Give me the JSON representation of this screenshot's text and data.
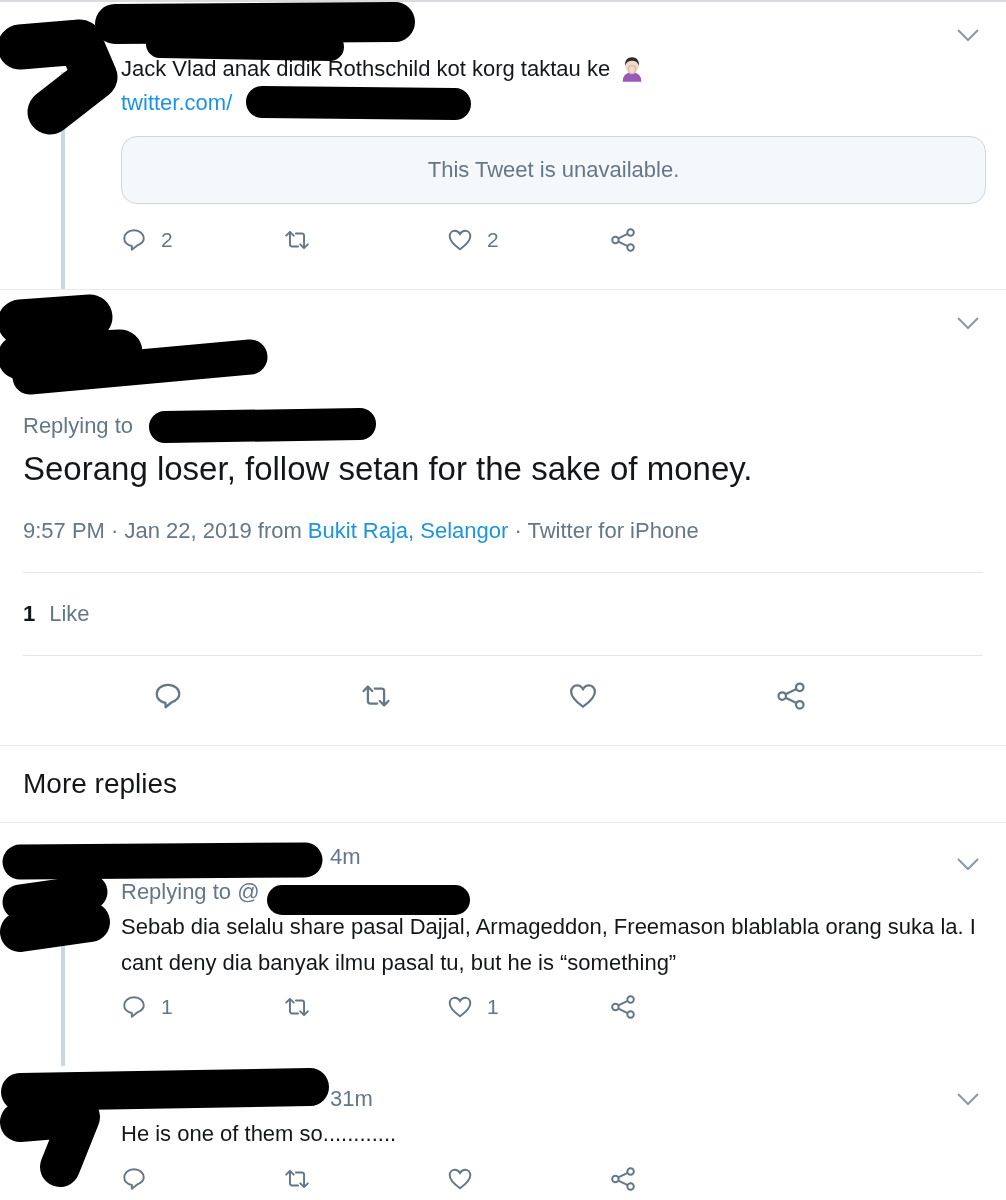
{
  "reply_above": {
    "text": "Jack Vlad anak didik Rothschild kot korg taktau ke",
    "link": "twitter.com/",
    "quoted": "This Tweet is unavailable.",
    "reply_count": "2",
    "like_count": "2"
  },
  "main_tweet": {
    "replying_to": "Replying to",
    "text": "Seorang loser, follow setan for the sake of money.",
    "time": "9:57 PM · Jan 22, 2019 from",
    "location": "Bukit Raja, Selangor",
    "source": "· Twitter for iPhone",
    "likes_count": "1",
    "likes_label": "Like"
  },
  "more_replies": {
    "title": "More replies",
    "replies": [
      {
        "time": "4m",
        "replying_to": "Replying to @",
        "text": "Sebab dia selalu share pasal Dajjal, Armageddon, Freemason blablabla orang suka la. I cant deny dia banyak ilmu pasal tu, but he is “something”",
        "reply_count": "1",
        "like_count": "1"
      },
      {
        "time": "31m",
        "text": "He is one of them so............"
      }
    ]
  }
}
